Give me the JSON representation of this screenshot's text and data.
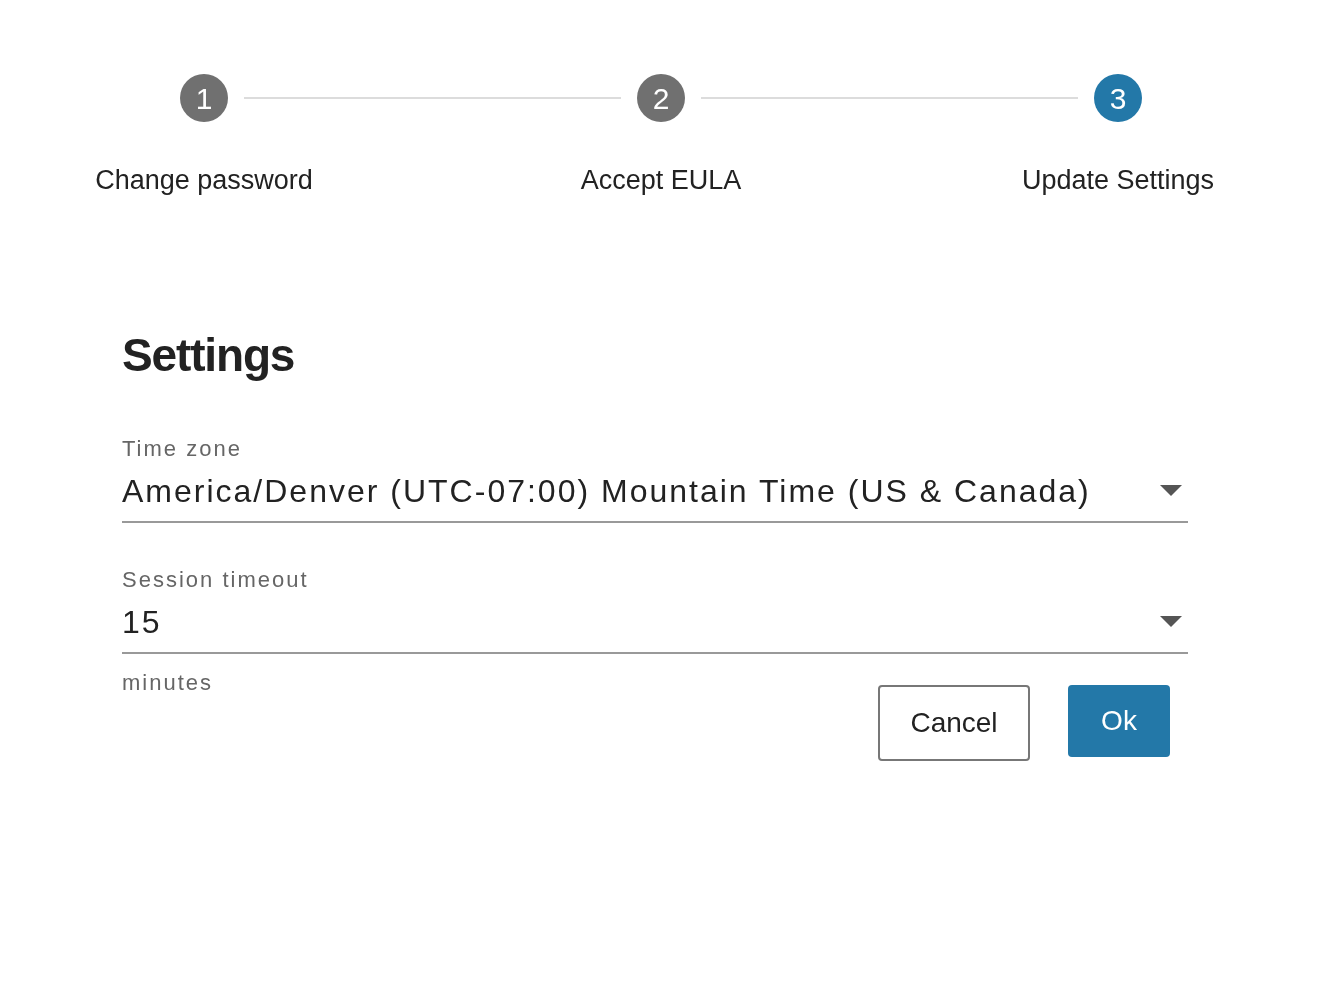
{
  "steps": [
    {
      "number": "1",
      "label": "Change password",
      "selected": false
    },
    {
      "number": "2",
      "label": "Accept EULA",
      "selected": false
    },
    {
      "number": "3",
      "label": "Update Settings",
      "selected": true
    }
  ],
  "title": "Settings",
  "fields": [
    {
      "label": "Time zone",
      "value": "America/Denver (UTC-07:00) Mountain Time (US & Canada)"
    },
    {
      "label": "Session timeout",
      "value": "15",
      "helper": "minutes"
    }
  ],
  "buttons": [
    {
      "label": "Cancel",
      "kind": "secondary"
    },
    {
      "label": "Ok",
      "kind": "primary"
    }
  ]
}
